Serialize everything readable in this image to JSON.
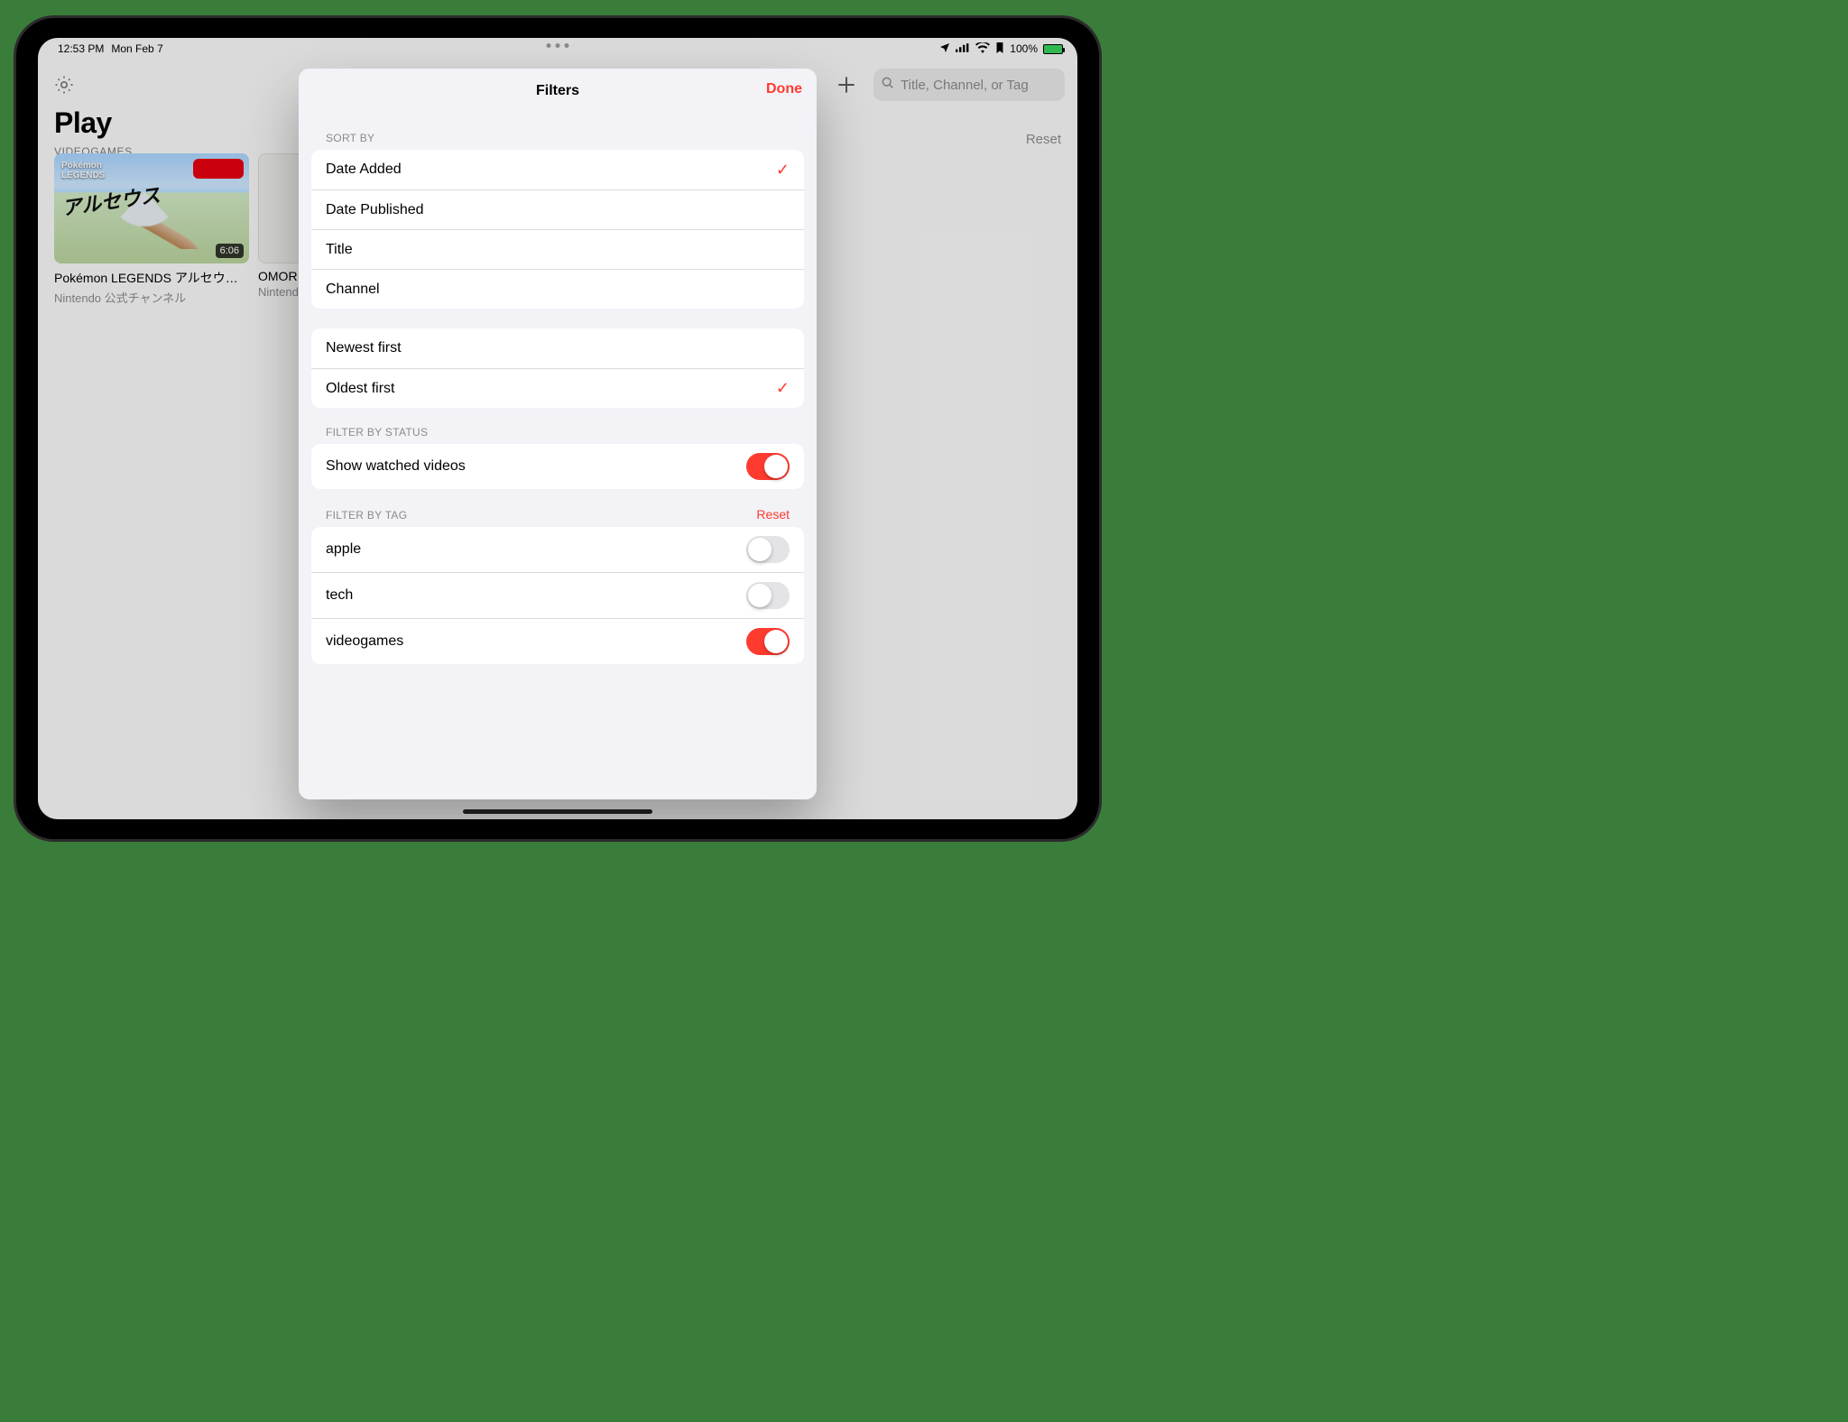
{
  "status": {
    "time": "12:53 PM",
    "date": "Mon Feb 7",
    "battery": "100%"
  },
  "header": {
    "search_placeholder": "Title, Channel, or Tag",
    "reset": "Reset"
  },
  "app": {
    "title": "Play",
    "category": "VIDEOGAMES"
  },
  "videos": [
    {
      "title": "Pokémon LEGENDS アルセウス 紹...",
      "channel": "Nintendo 公式チャンネル",
      "duration": "6:06",
      "thumb_logo_top": "Pokémon",
      "thumb_logo_sub": "LEGENDS",
      "thumb_script": "アルセウス"
    },
    {
      "title": "OMOR",
      "channel": "Nintend"
    }
  ],
  "sheet": {
    "title": "Filters",
    "done": "Done",
    "sort_by_header": "SORT BY",
    "sort_by": [
      {
        "label": "Date Added",
        "checked": true
      },
      {
        "label": "Date Published",
        "checked": false
      },
      {
        "label": "Title",
        "checked": false
      },
      {
        "label": "Channel",
        "checked": false
      }
    ],
    "order": [
      {
        "label": "Newest first",
        "checked": false
      },
      {
        "label": "Oldest first",
        "checked": true
      }
    ],
    "filter_status_header": "FILTER BY STATUS",
    "show_watched_label": "Show watched videos",
    "show_watched_on": true,
    "filter_tag_header": "FILTER BY TAG",
    "filter_tag_reset": "Reset",
    "tags": [
      {
        "label": "apple",
        "on": false
      },
      {
        "label": "tech",
        "on": false
      },
      {
        "label": "videogames",
        "on": true
      }
    ]
  }
}
